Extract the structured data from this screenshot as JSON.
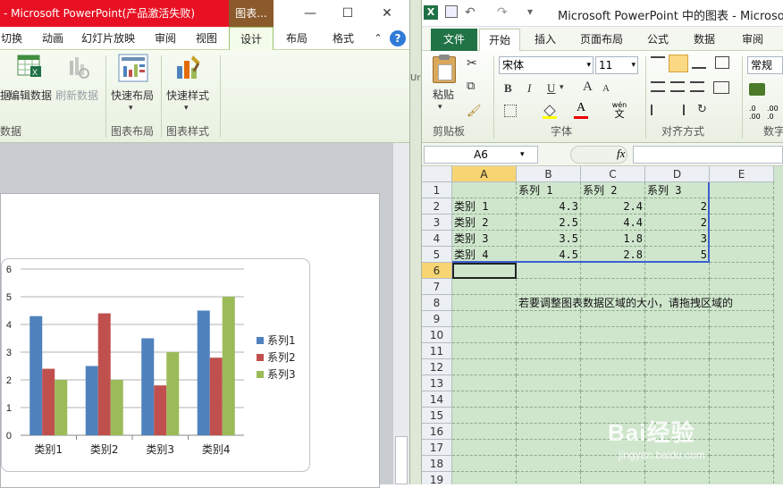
{
  "ppt": {
    "title": "- Microsoft PowerPoint(产品激活失败)",
    "context_tab": "图表...",
    "tabs": [
      "切换",
      "动画",
      "幻灯片放映",
      "审阅",
      "视图",
      "设计",
      "布局",
      "格式"
    ],
    "active_tab": "设计",
    "ribbon": {
      "btn_edit_cut": "据",
      "btn_edit": "编辑数据",
      "btn_refresh": "刷新数据",
      "btn_quick_layout": "快速布局",
      "btn_quick_style": "快速样式",
      "group_data": "数据",
      "group_layout": "图表布局",
      "group_style": "图表样式"
    }
  },
  "chart_data": {
    "type": "bar",
    "categories": [
      "类别1",
      "类别2",
      "类别3",
      "类别4"
    ],
    "series": [
      {
        "name": "系列1",
        "values": [
          4.3,
          2.5,
          3.5,
          4.5
        ],
        "color": "#4f81bd"
      },
      {
        "name": "系列2",
        "values": [
          2.4,
          4.4,
          1.8,
          2.8
        ],
        "color": "#c0504d"
      },
      {
        "name": "系列3",
        "values": [
          2,
          2,
          3,
          5
        ],
        "color": "#9bbb59"
      }
    ],
    "y_ticks": [
      "0",
      "1",
      "2",
      "3",
      "4",
      "5",
      "6"
    ],
    "ylim": [
      0,
      6
    ],
    "legend_position": "right",
    "grid": true
  },
  "excel": {
    "title": "Microsoft PowerPoint 中的图表 - Microsoft",
    "tabs": [
      "文件",
      "开始",
      "插入",
      "页面布局",
      "公式",
      "数据",
      "审阅"
    ],
    "active_tab": "开始",
    "ribbon": {
      "paste": "粘贴",
      "clipboard": "剪贴板",
      "font_name": "宋体",
      "font_size": "11",
      "font_group": "字体",
      "align_group": "对齐方式",
      "number_format": "常规",
      "number_group": "数字",
      "bold": "B",
      "italic": "I",
      "underline": "U",
      "font_grow": "A",
      "font_shrink": "A",
      "font_color_letter": "A",
      "wen": "wén",
      "wen_char": "文",
      "quick_num1": ".0",
      "quick_num2": ".00",
      "quick_num3": ".00",
      "quick_num4": ".0"
    },
    "name_box": "A6",
    "fx": "fx",
    "columns": [
      "A",
      "B",
      "C",
      "D",
      "E"
    ],
    "rows": [
      "1",
      "2",
      "3",
      "4",
      "5",
      "6",
      "7",
      "8",
      "9",
      "10",
      "11",
      "12",
      "13",
      "14",
      "15",
      "16",
      "17",
      "18",
      "19"
    ],
    "cells": {
      "B1": "系列 1",
      "C1": "系列 2",
      "D1": "系列 3",
      "A2": "类别 1",
      "B2": "4.3",
      "C2": "2.4",
      "D2": "2",
      "A3": "类别 2",
      "B3": "2.5",
      "C3": "4.4",
      "D3": "2",
      "A4": "类别 3",
      "B4": "3.5",
      "C4": "1.8",
      "D4": "3",
      "A5": "类别 4",
      "B5": "4.5",
      "C5": "2.8",
      "D5": "5",
      "B8": "若要调整图表数据区域的大小，请拖拽区域的"
    }
  },
  "watermark": {
    "logo": "Bai经验",
    "url": "jingyan.baidu.com"
  }
}
